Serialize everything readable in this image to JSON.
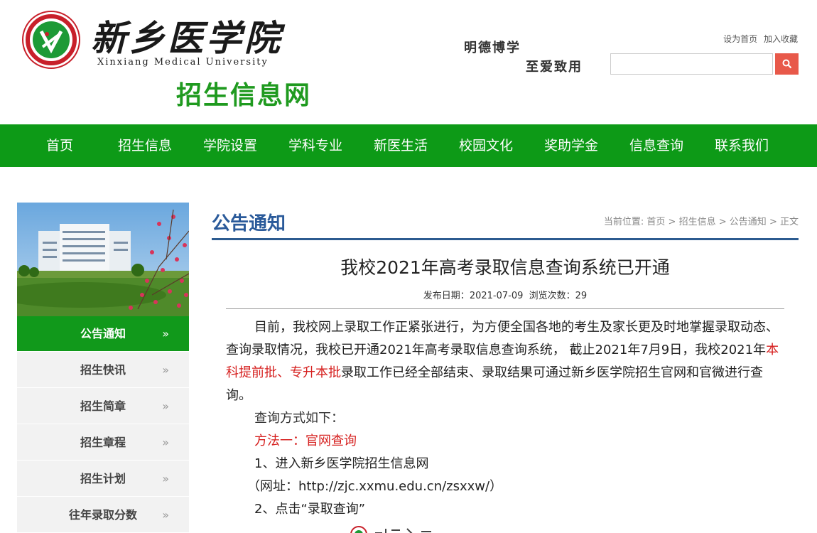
{
  "header": {
    "logo_cn": "新乡医学院",
    "logo_en": "Xinxiang Medical University",
    "site_name": "招生信息网",
    "motto_line1": "明德博学",
    "motto_line2": "至爱致用",
    "top_links": [
      "设为首页",
      "加入收藏"
    ],
    "search": {
      "placeholder": "",
      "value": "",
      "icon": "search-icon"
    }
  },
  "nav": {
    "items": [
      "首页",
      "招生信息",
      "学院设置",
      "学科专业",
      "新医生活",
      "校园文化",
      "奖助学金",
      "信息查询",
      "联系我们"
    ]
  },
  "sidebar": {
    "arrow_glyph": "»",
    "items": [
      {
        "label": "公告通知",
        "active": true
      },
      {
        "label": "招生快讯",
        "active": false
      },
      {
        "label": "招生简章",
        "active": false
      },
      {
        "label": "招生章程",
        "active": false
      },
      {
        "label": "招生计划",
        "active": false
      },
      {
        "label": "往年录取分数",
        "active": false
      }
    ]
  },
  "main": {
    "section_title": "公告通知",
    "breadcrumb": {
      "prefix": "当前位置:",
      "items": [
        "首页",
        "招生信息",
        "公告通知",
        "正文"
      ],
      "separator": ">"
    },
    "article": {
      "title": "我校2021年高考录取信息查询系统已开通",
      "publish_label": "发布日期：",
      "publish_date": "2021-07-09",
      "views_label": "浏览次数：",
      "views": "29",
      "para1_a": "目前，我校网上录取工作正紧张进行，为方便全国各地的考生及家长更及时地掌握录取动态、查询录取情况，我校已开通2021年高考录取信息查询系统， 截止2021年7月9日，我校2021年",
      "para1_red": "本科提前批、专升本批",
      "para1_b": "录取工作已经全部结束、录取结果可通过新乡医学院招生官网和官微进行查询。",
      "query_intro": "查询方式如下：",
      "method1": "方法一：官网查询",
      "step1": "1、进入新乡医学院招生信息网",
      "url_line": "（网址：http://zjc.xxmu.edu.cn/zsxxw/）",
      "step2": "2、点击“录取查询”"
    }
  },
  "colors": {
    "nav_green": "#0d9a17",
    "site_name_green": "#1f9a1f",
    "section_blue": "#2a5a9a",
    "highlight_red": "#d6201f",
    "search_button": "#e8594a"
  }
}
